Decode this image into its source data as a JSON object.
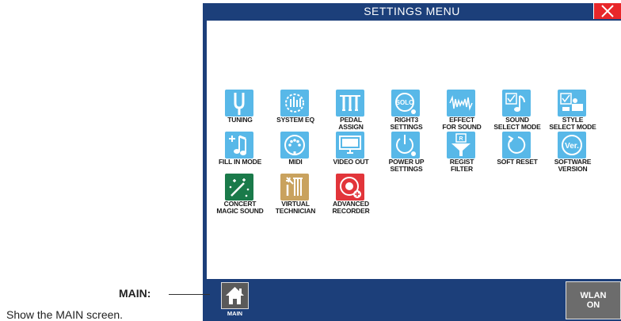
{
  "window": {
    "title": "SETTINGS MENU"
  },
  "icons": [
    {
      "label": "TUNING",
      "icon": "tuning-fork-icon"
    },
    {
      "label": "SYSTEM EQ",
      "icon": "system-eq-icon"
    },
    {
      "label": "PEDAL\nASSIGN",
      "icon": "pedal-icon"
    },
    {
      "label": "RIGHT3\nSETTINGS",
      "icon": "solo-gear-icon"
    },
    {
      "label": "EFFECT\nFOR SOUND",
      "icon": "waveform-icon"
    },
    {
      "label": "SOUND\nSELECT MODE",
      "icon": "note-check-icon"
    },
    {
      "label": "STYLE\nSELECT MODE",
      "icon": "style-select-icon"
    },
    {
      "label": "FILL IN MODE",
      "icon": "fill-in-icon"
    },
    {
      "label": "MIDI",
      "icon": "midi-icon"
    },
    {
      "label": "VIDEO OUT",
      "icon": "monitor-icon"
    },
    {
      "label": "POWER UP\nSETTINGS",
      "icon": "power-gear-icon"
    },
    {
      "label": "REGIST\nFILTER",
      "icon": "filter-icon"
    },
    {
      "label": "SOFT RESET",
      "icon": "reset-icon"
    },
    {
      "label": "SOFTWARE\nVERSION",
      "icon": "version-icon"
    },
    {
      "label": "CONCERT\nMAGIC SOUND",
      "icon": "magic-wand-icon"
    },
    {
      "label": "VIRTUAL\nTECHNICIAN",
      "icon": "technician-icon"
    },
    {
      "label": "ADVANCED\nRECORDER",
      "icon": "recorder-icon"
    }
  ],
  "bottom": {
    "main_label": "MAIN",
    "wlan_line1": "WLAN",
    "wlan_line2": "ON"
  },
  "annotation": {
    "title": "MAIN:",
    "description": "Show the MAIN screen."
  },
  "colors": {
    "frame": "#1c3f7a",
    "tile_blue": "#58b8e8",
    "tile_green": "#1a7a4a",
    "tile_tan": "#c9a25e",
    "tile_red": "#e2353a",
    "close": "#e8272a"
  }
}
